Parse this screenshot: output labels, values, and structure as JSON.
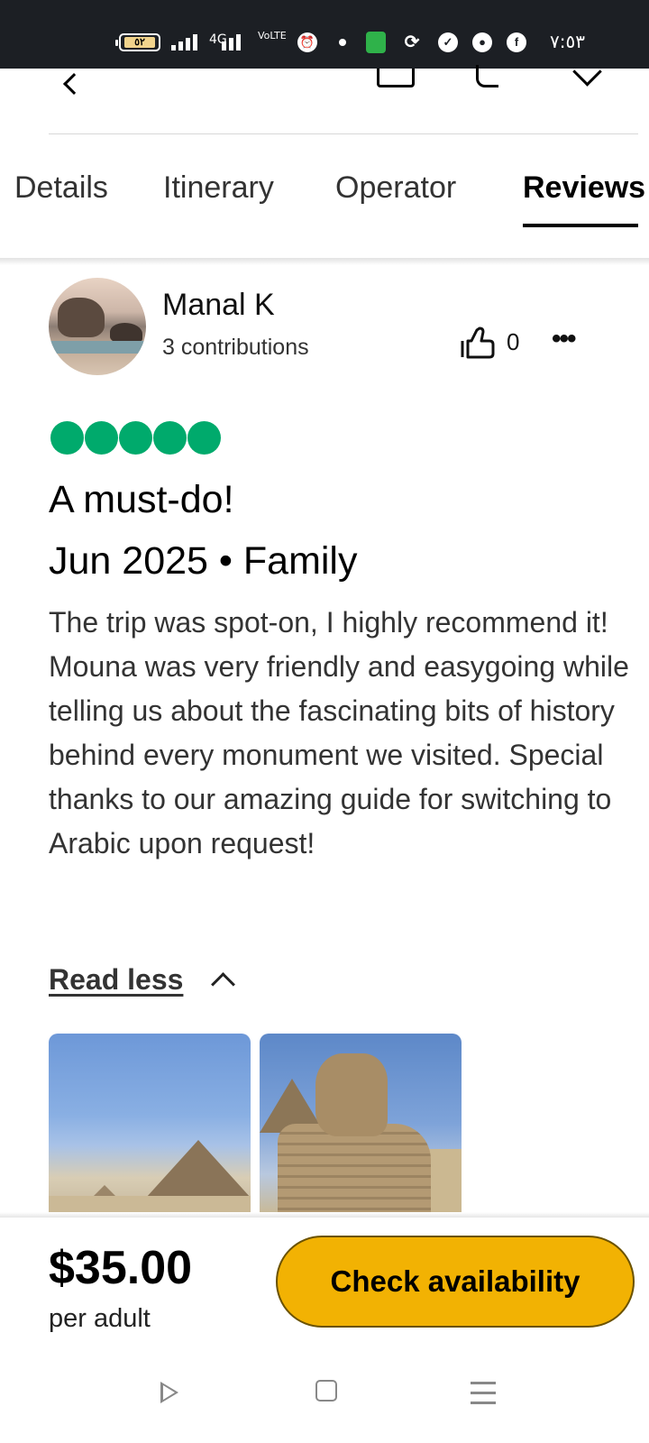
{
  "status_bar": {
    "battery": "٥٢",
    "network": "4G",
    "volte": "VoLTE",
    "time": "٧:٥٣"
  },
  "top_actions": [
    "back",
    "share",
    "write-review",
    "save"
  ],
  "tabs": [
    {
      "label": "Details",
      "active": false
    },
    {
      "label": "Itinerary",
      "active": false
    },
    {
      "label": "Operator",
      "active": false
    },
    {
      "label": "Reviews",
      "active": true
    }
  ],
  "review": {
    "author": "Manal K",
    "contributions": "3 contributions",
    "likes": "0",
    "rating": 5,
    "rating_max": 5,
    "title": "A must-do!",
    "meta": "Jun 2025 • Family",
    "body": [
      "The trip was spot-on, I highly recommend it!",
      "Mouna was very friendly and easygoing while telling us about the fascinating bits of history behind every monument we visited. Special thanks to our amazing guide for switching to Arabic upon request!"
    ],
    "read_less_label": "Read less",
    "photos": [
      "pyramids-photo",
      "sphinx-photo"
    ]
  },
  "booking": {
    "price": "$35.00",
    "price_unit": "per adult",
    "cta_label": "Check availability"
  },
  "colors": {
    "rating_green": "#00aa6c",
    "cta_yellow": "#f2b203",
    "status_bar_bg": "#1c1f24"
  }
}
